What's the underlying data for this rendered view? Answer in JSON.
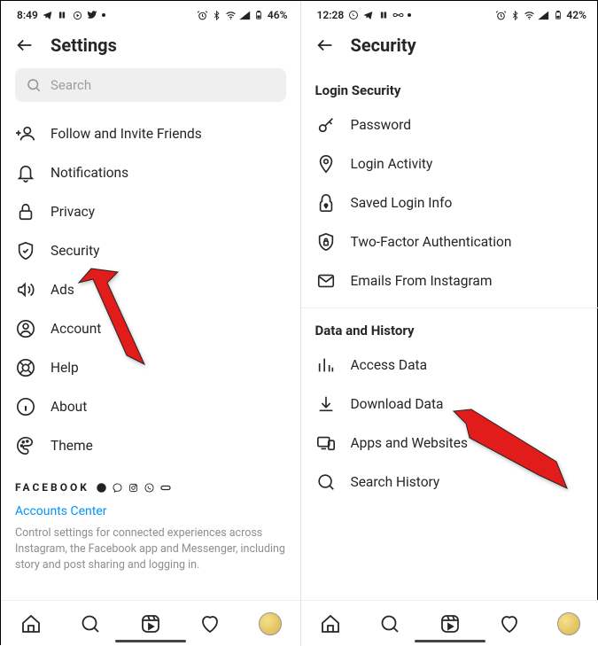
{
  "left": {
    "status": {
      "time": "8:49",
      "battery": "46%"
    },
    "title": "Settings",
    "search_placeholder": "Search",
    "items": [
      {
        "key": "follow",
        "label": "Follow and Invite Friends"
      },
      {
        "key": "notif",
        "label": "Notifications"
      },
      {
        "key": "privacy",
        "label": "Privacy"
      },
      {
        "key": "security",
        "label": "Security"
      },
      {
        "key": "ads",
        "label": "Ads"
      },
      {
        "key": "account",
        "label": "Account"
      },
      {
        "key": "help",
        "label": "Help"
      },
      {
        "key": "about",
        "label": "About"
      },
      {
        "key": "theme",
        "label": "Theme"
      }
    ],
    "brand": "FACEBOOK",
    "accounts_center": "Accounts Center",
    "brand_desc": "Control settings for connected experiences across Instagram, the Facebook app and Messenger, including story and post sharing and logging in."
  },
  "right": {
    "status": {
      "time": "12:28",
      "battery": "42%"
    },
    "title": "Security",
    "section1": "Login Security",
    "items1": [
      {
        "key": "password",
        "label": "Password"
      },
      {
        "key": "login_activity",
        "label": "Login Activity"
      },
      {
        "key": "saved_login",
        "label": "Saved Login Info"
      },
      {
        "key": "twofactor",
        "label": "Two-Factor Authentication"
      },
      {
        "key": "emails",
        "label": "Emails From Instagram"
      }
    ],
    "section2": "Data and History",
    "items2": [
      {
        "key": "access",
        "label": "Access Data"
      },
      {
        "key": "download",
        "label": "Download Data"
      },
      {
        "key": "apps",
        "label": "Apps and Websites"
      },
      {
        "key": "search_history",
        "label": "Search History"
      }
    ]
  }
}
